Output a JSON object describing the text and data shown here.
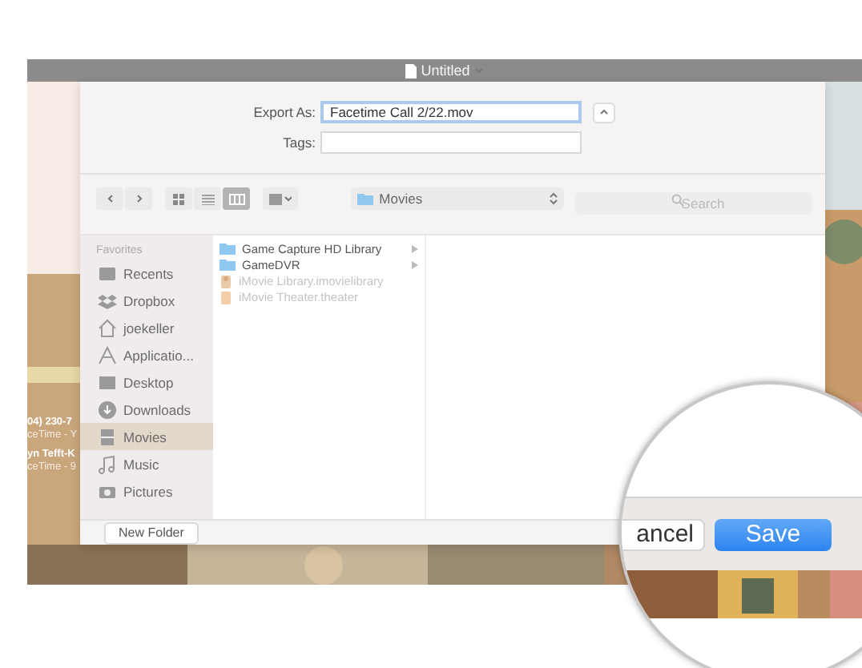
{
  "window": {
    "title": "Untitled"
  },
  "export_as": {
    "label": "Export As:",
    "value": "Facetime Call 2/22.mov"
  },
  "tags": {
    "label": "Tags:"
  },
  "toolbar": {
    "views": [
      {
        "kind": "icons",
        "selected": false
      },
      {
        "kind": "list",
        "selected": false
      },
      {
        "kind": "columns",
        "selected": true
      }
    ],
    "location": "Movies",
    "search": {
      "placeholder": "Search"
    }
  },
  "sidebar": {
    "heading": "Favorites",
    "items": [
      {
        "label": "Recents",
        "kind": "recents",
        "selected": false
      },
      {
        "label": "Dropbox",
        "kind": "dropbox",
        "selected": false
      },
      {
        "label": "joekeller",
        "kind": "home",
        "selected": false
      },
      {
        "label": "Applicatio...",
        "kind": "apps",
        "selected": false
      },
      {
        "label": "Desktop",
        "kind": "desktop",
        "selected": false
      },
      {
        "label": "Downloads",
        "kind": "downloads",
        "selected": false
      },
      {
        "label": "Movies",
        "kind": "movies",
        "selected": true
      },
      {
        "label": "Music",
        "kind": "music",
        "selected": false
      },
      {
        "label": "Pictures",
        "kind": "pictures",
        "selected": false
      }
    ]
  },
  "files": [
    {
      "name": "Game Capture HD Library",
      "kind": "folder"
    },
    {
      "name": "GameDVR",
      "kind": "folder"
    },
    {
      "name": "iMovie Library.imovielibrary",
      "kind": "package"
    },
    {
      "name": "iMovie Theater.theater",
      "kind": "theater"
    }
  ],
  "background_app": {
    "lines": [
      "04) 230-7",
      "ceTime - Y",
      "yn Tefft-K",
      "ceTime - 9"
    ]
  },
  "new_folder_button": "New Folder",
  "cancel_button": "ancel",
  "save_button": "Save"
}
